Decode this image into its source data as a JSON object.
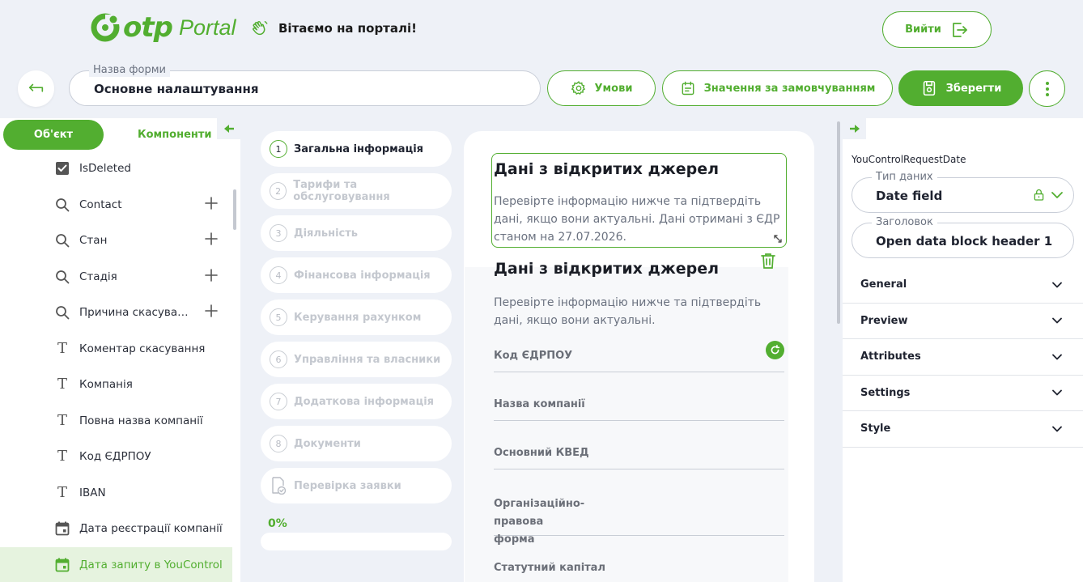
{
  "header": {
    "logo_brand": "otp",
    "logo_portal": "Portal",
    "welcome": "Вітаємо на порталі!",
    "logout_label": "Вийти"
  },
  "toolbar": {
    "form_name_label": "Назва форми",
    "form_name_value": "Основне налаштування",
    "conditions_label": "Умови",
    "defaults_label": "Значення за замовчуванням",
    "save_label": "Зберегти"
  },
  "left_panel": {
    "tab_object": "Об'єкт",
    "tab_components": "Компоненти",
    "items": [
      {
        "label": "IsDeleted",
        "icon": "checkbox-icon",
        "plus": false
      },
      {
        "label": "Contact",
        "icon": "search-icon",
        "plus": true
      },
      {
        "label": "Стан",
        "icon": "search-icon",
        "plus": true
      },
      {
        "label": "Стадія",
        "icon": "search-icon",
        "plus": true
      },
      {
        "label": "Причина скасува…",
        "icon": "search-icon",
        "plus": true
      },
      {
        "label": "Коментар скасування",
        "icon": "text-icon",
        "plus": false
      },
      {
        "label": "Компанія",
        "icon": "text-icon",
        "plus": false
      },
      {
        "label": "Повна назва компанії",
        "icon": "text-icon",
        "plus": false
      },
      {
        "label": "Код ЄДРПОУ",
        "icon": "text-icon",
        "plus": false
      },
      {
        "label": "IBAN",
        "icon": "text-icon",
        "plus": false
      },
      {
        "label": "Дата реєстрації компанії",
        "icon": "calendar-icon",
        "plus": false
      },
      {
        "label": "Дата запиту в YouControl",
        "icon": "calendar-icon",
        "plus": false,
        "active": true
      }
    ]
  },
  "steps": {
    "items": [
      {
        "num": "1",
        "label": "Загальна інформація",
        "current": true
      },
      {
        "num": "2",
        "label": "Тарифи та обслуговування",
        "current": false
      },
      {
        "num": "3",
        "label": "Діяльність",
        "current": false
      },
      {
        "num": "4",
        "label": "Фінансова інформація",
        "current": false
      },
      {
        "num": "5",
        "label": "Керування рахунком",
        "current": false
      },
      {
        "num": "6",
        "label": "Управління та власники",
        "current": false
      },
      {
        "num": "7",
        "label": "Додаткова інформація",
        "current": false
      },
      {
        "num": "8",
        "label": "Документи",
        "current": false
      },
      {
        "num": "",
        "label": "Перевірка заявки",
        "current": false,
        "icon": "document-check-icon"
      }
    ],
    "progress_text": "0%",
    "progress_value": 0
  },
  "center": {
    "block1_title": "Дані з відкритих джерел",
    "block1_desc": "Перевірте інформацію нижче та підтвердіть дані, якщо вони актуальні. Дані отримані з ЄДР станом на 27.07.2026.",
    "block2_title": "Дані з відкритих джерел",
    "block2_desc": "Перевірте інформацію нижче та підтвердіть дані, якщо вони актуальні.",
    "fields": [
      "Код ЄДРПОУ",
      "Назва компанії",
      "Основний КВЕД",
      "Організаційно-правова форма",
      "Статутний капітал"
    ]
  },
  "right_panel": {
    "prop_name": "YouControlRequestDate",
    "data_type_label": "Тип даних",
    "data_type_value": "Date field",
    "header_label": "Заголовок",
    "header_value": "Open data block header 1",
    "sections": [
      "General",
      "Preview",
      "Attributes",
      "Settings",
      "Style"
    ]
  },
  "colors": {
    "accent": "#52ae30",
    "background": "#eef1f7",
    "panel": "#ffffff",
    "active_row": "#e6f3df"
  }
}
